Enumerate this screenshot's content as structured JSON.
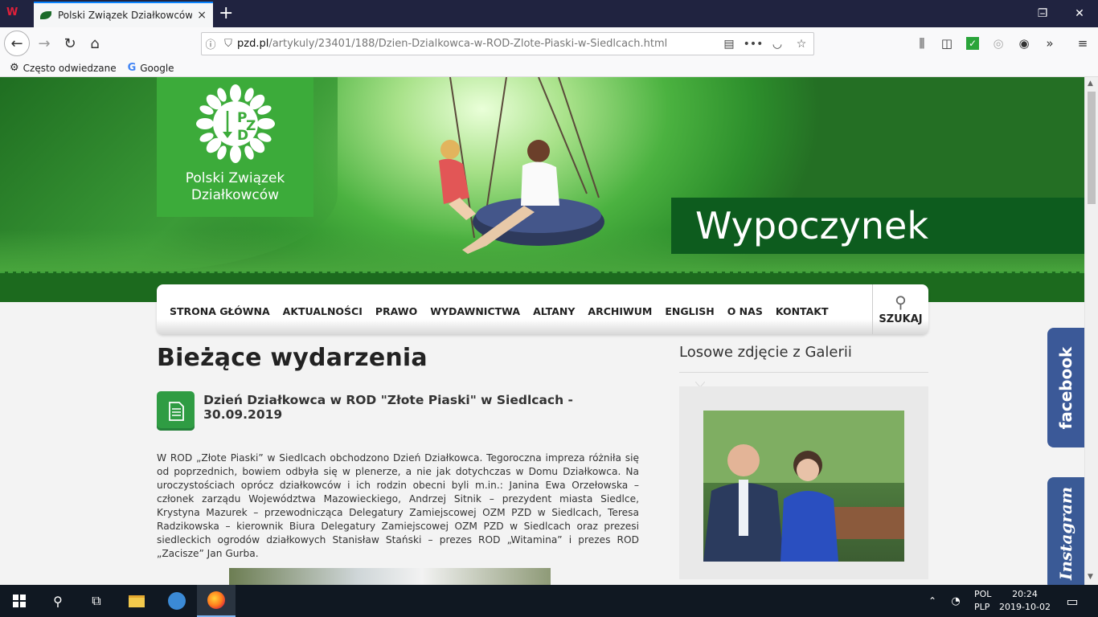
{
  "browser": {
    "tab_title": "Polski Związek Działkowców - D",
    "tab_close": "×",
    "new_tab": "+",
    "url_domain": "pzd.pl",
    "url_path": "/artykuly/23401/188/Dzien-Dzialkowca-w-ROD-Zlote-Piaski-w-Siedlcach.html",
    "bookmarks": [
      {
        "label": "Często odwiedzane",
        "icon": "gear-icon"
      },
      {
        "label": "Google",
        "icon": "google-icon"
      }
    ],
    "window_controls": [
      "–",
      "❐",
      "✕"
    ]
  },
  "site": {
    "logo_letters": [
      "P",
      "Z",
      "D"
    ],
    "logo_name_line1": "Polski Związek",
    "logo_name_line2": "Działkowców",
    "banner_caption": "Wypoczynek",
    "menu": [
      "STRONA GŁÓWNA",
      "AKTUALNOŚCI",
      "PRAWO",
      "WYDAWNICTWA",
      "ALTANY",
      "ARCHIWUM",
      "ENGLISH",
      "O NAS",
      "KONTAKT"
    ],
    "search_label": "SZUKAJ"
  },
  "main": {
    "section_title": "Bieżące wydarzenia",
    "article_title": "Dzień Działkowca w ROD \"Złote Piaski\" w Siedlcach - 30.09.2019",
    "article_body": "W ROD „Złote Piaski” w Siedlcach obchodzono Dzień Działkowca. Tegoroczna impreza różniła się od poprzednich, bowiem odbyła się w plenerze, a nie jak dotychczas w Domu Działkowca. Na uroczystościach oprócz działkowców i ich rodzin obecni byli m.in.: Janina Ewa Orzełowska – członek zarządu Województwa Mazowieckiego, Andrzej Sitnik – prezydent miasta Siedlce, Krystyna Mazurek – przewodnicząca Delegatury Zamiejscowej OZM PZD w Siedlcach, Teresa Radzikowska – kierownik Biura Delegatury Zamiejscowej OZM PZD w Siedlcach oraz prezesi siedleckich ogrodów działkowych Stanisław Stański – prezes ROD „Witamina” i prezes ROD „Zacisze” Jan Gurba."
  },
  "sidebar": {
    "title": "Losowe zdjęcie z Galerii"
  },
  "social": {
    "facebook": "facebook",
    "instagram": "Instagram"
  },
  "taskbar": {
    "lang1": "POL",
    "lang2": "PLP",
    "time": "20:24",
    "date": "2019-10-02"
  },
  "colors": {
    "brand_green": "#3cab3a",
    "banner_dark_green": "#0d5c1e",
    "facebook_blue": "#3b5998"
  }
}
